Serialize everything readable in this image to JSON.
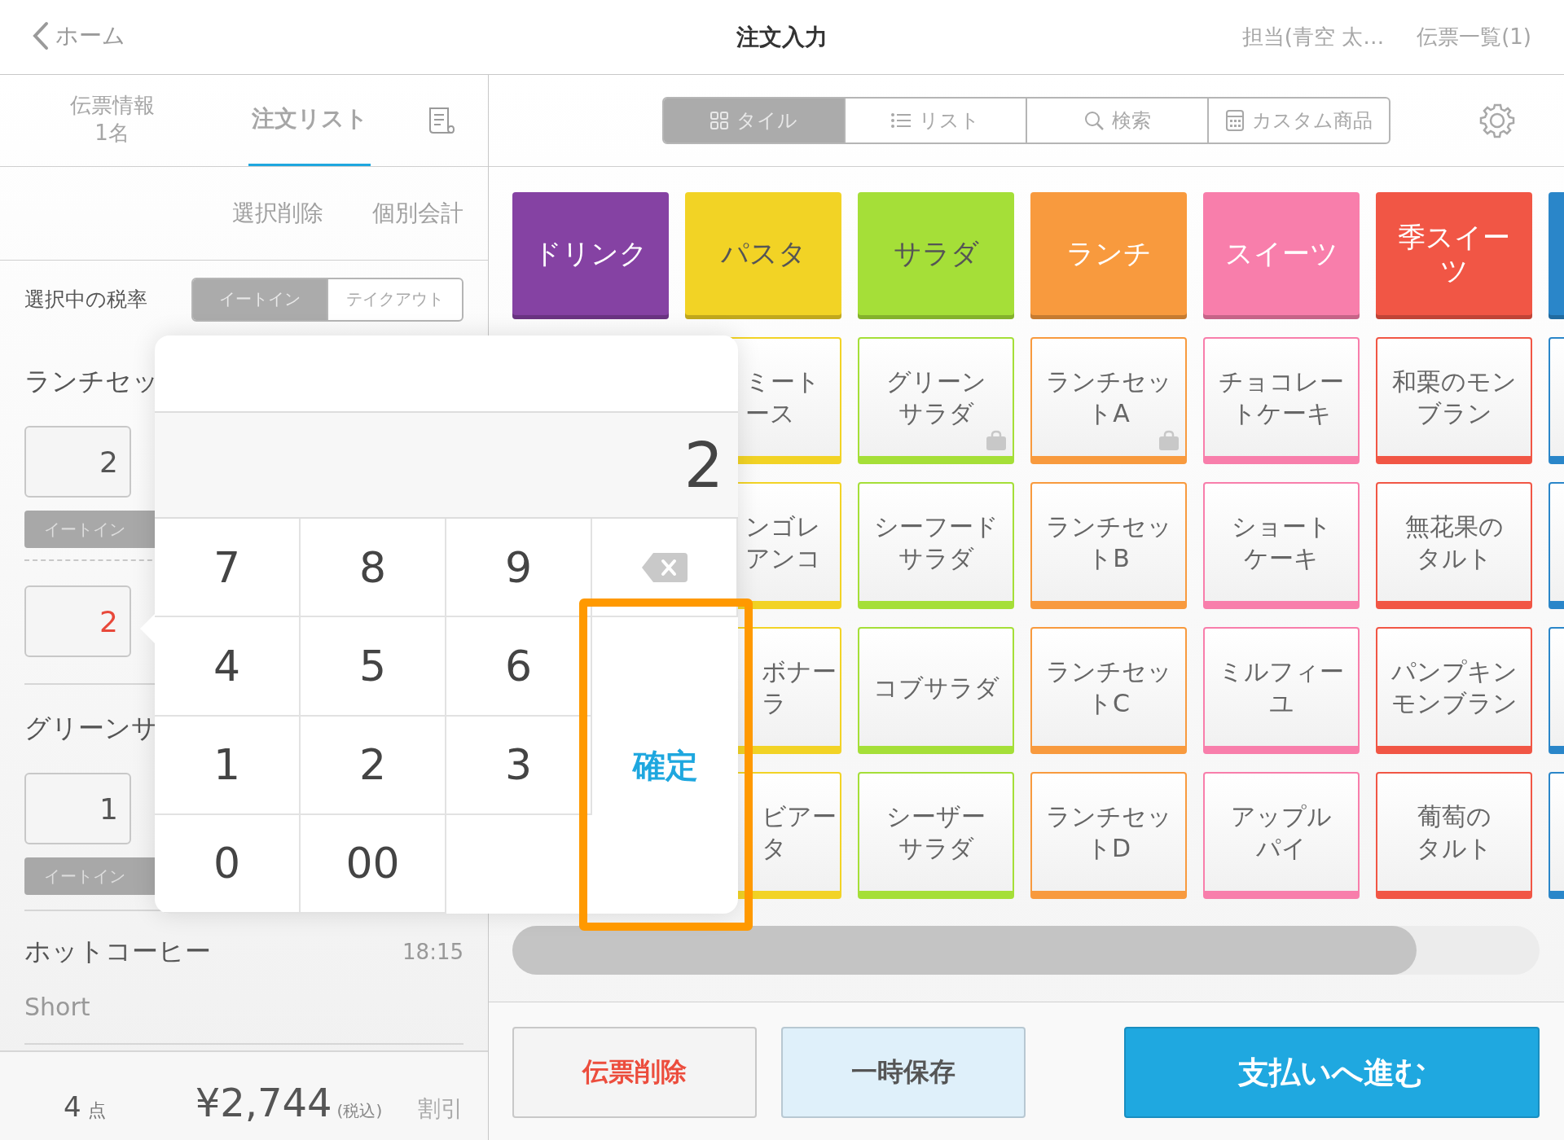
{
  "header": {
    "back": "ホーム",
    "title": "注文入力",
    "staff": "担当(青空 太…",
    "slips": "伝票一覧(1)"
  },
  "left_tabs": [
    {
      "label": "伝票情報",
      "sub": "1名",
      "selected": false
    },
    {
      "label": "注文リスト",
      "selected": true
    }
  ],
  "actions": [
    "選択削除",
    "個別会計"
  ],
  "tax": {
    "label": "選択中の税率",
    "options": [
      {
        "label": "イートイン",
        "selected": true
      },
      {
        "label": "テイクアウト",
        "selected": false
      }
    ]
  },
  "orders": [
    {
      "name": "ランチセッ",
      "lines": [
        {
          "qty": "2",
          "tag": "イートイン",
          "editing": false
        },
        {
          "qty": "2",
          "editing": true
        }
      ]
    },
    {
      "name": "グリーンサ",
      "lines": [
        {
          "qty": "1",
          "tag": "イートイン",
          "editing": false
        }
      ]
    },
    {
      "name": "ホットコーヒー",
      "time": "18:15",
      "note": "Short"
    }
  ],
  "footer": {
    "count": "4",
    "count_unit": "点",
    "total": "¥2,744",
    "tax_note": "(税込)",
    "discount": "割引"
  },
  "view_tabs": [
    {
      "kind": "tile",
      "label": "タイル",
      "selected": true
    },
    {
      "kind": "list",
      "label": "リスト",
      "selected": false
    },
    {
      "kind": "search",
      "label": "検索",
      "selected": false
    },
    {
      "kind": "custom",
      "label": "カスタム商品",
      "selected": false
    }
  ],
  "categories": [
    {
      "name": [
        "ドリンク"
      ],
      "color": "#8542a3",
      "light_text": true
    },
    {
      "name": [
        "パスタ"
      ],
      "color": "#f2d325",
      "light_text": false,
      "items": [
        {
          "name": [
            "ミート",
            "ース"
          ],
          "bag": false
        },
        {
          "name": [
            "ンゴレ",
            "アンコ"
          ],
          "bag": false
        },
        {
          "name": [
            "ボナー",
            "ラ"
          ],
          "bag": false
        },
        {
          "name": [
            "ビアー",
            "タ"
          ],
          "bag": false
        }
      ]
    },
    {
      "name": [
        "サラダ"
      ],
      "color": "#a5df38",
      "light_text": false,
      "items": [
        {
          "name": [
            "グリーン",
            "サラダ"
          ],
          "bag": true
        },
        {
          "name": [
            "シーフード",
            "サラダ"
          ],
          "bag": false
        },
        {
          "name": [
            "コブサラダ"
          ],
          "bag": false
        },
        {
          "name": [
            "シーザー",
            "サラダ"
          ],
          "bag": false
        }
      ]
    },
    {
      "name": [
        "ランチ"
      ],
      "color": "#f89a3e",
      "light_text": true,
      "items": [
        {
          "name": [
            "ランチセッ",
            "トA"
          ],
          "bag": true
        },
        {
          "name": [
            "ランチセッ",
            "トB"
          ],
          "bag": false
        },
        {
          "name": [
            "ランチセッ",
            "トC"
          ],
          "bag": false
        },
        {
          "name": [
            "ランチセッ",
            "トD"
          ],
          "bag": false
        }
      ]
    },
    {
      "name": [
        "スイーツ"
      ],
      "color": "#f87eab",
      "light_text": true,
      "items": [
        {
          "name": [
            "チョコレー",
            "トケーキ"
          ],
          "bag": false
        },
        {
          "name": [
            "ショート",
            "ケーキ"
          ],
          "bag": false
        },
        {
          "name": [
            "ミルフィー",
            "ユ"
          ],
          "bag": false
        },
        {
          "name": [
            "アップル",
            "パイ"
          ],
          "bag": false
        }
      ]
    },
    {
      "name": [
        "季スイー",
        "ツ"
      ],
      "color": "#f15645",
      "light_text": true,
      "items": [
        {
          "name": [
            "和栗のモン",
            "ブラン"
          ],
          "bag": false
        },
        {
          "name": [
            "無花果の",
            "タルト"
          ],
          "bag": false
        },
        {
          "name": [
            "パンプキン",
            "モンブラン"
          ],
          "bag": false
        },
        {
          "name": [
            "葡萄の",
            "タルト"
          ],
          "bag": false
        }
      ]
    },
    {
      "color": "#2a86c9",
      "items": [
        {
          "bag": false
        },
        {
          "bag": false
        },
        {
          "bag": false
        },
        {
          "bag": false
        }
      ]
    }
  ],
  "buttons": [
    {
      "label": "伝票削除",
      "kind": "danger"
    },
    {
      "label": "一時保存",
      "kind": "save"
    },
    {
      "label": "支払いへ進む",
      "kind": "primary"
    }
  ],
  "keypad": {
    "value": "2",
    "keys": [
      {
        "label": "7",
        "kind": "digit"
      },
      {
        "label": "8",
        "kind": "digit"
      },
      {
        "label": "9",
        "kind": "digit"
      },
      {
        "kind": "backspace"
      },
      {
        "label": "4",
        "kind": "digit"
      },
      {
        "label": "5",
        "kind": "digit"
      },
      {
        "label": "6",
        "kind": "digit"
      },
      {
        "label": "1",
        "kind": "digit"
      },
      {
        "label": "2",
        "kind": "digit"
      },
      {
        "label": "3",
        "kind": "digit"
      },
      {
        "label": "確定",
        "kind": "confirm",
        "highlighted": true
      },
      {
        "label": "0",
        "kind": "digit"
      },
      {
        "label": "00",
        "kind": "digit"
      }
    ]
  }
}
